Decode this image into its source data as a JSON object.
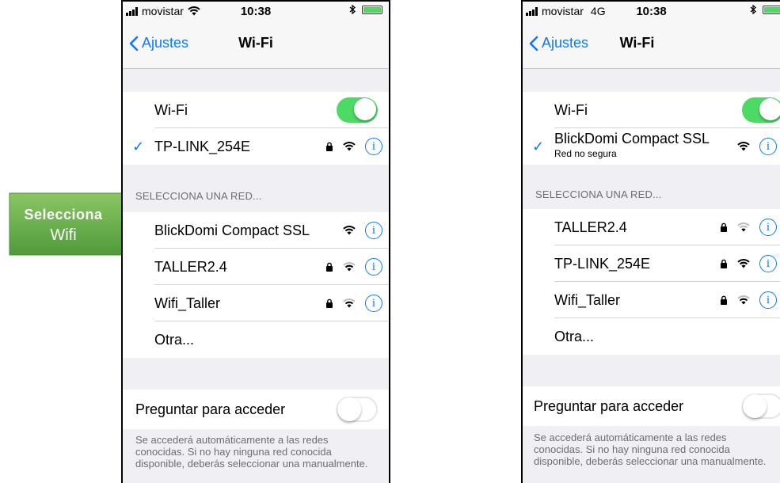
{
  "callout": {
    "line1": "Selecciona",
    "line2": "Wifi"
  },
  "left": {
    "status": {
      "carrier": "movistar",
      "time": "10:38"
    },
    "nav": {
      "back": "Ajustes",
      "title": "Wi-Fi"
    },
    "wifi_label": "Wi-Fi",
    "wifi_on": true,
    "connected": {
      "ssid": "TP-LINK_254E",
      "locked": true
    },
    "section_header": "SELECCIONA UNA RED...",
    "networks": [
      {
        "ssid": "BlickDomi Compact SSL",
        "locked": false
      },
      {
        "ssid": "TALLER2.4",
        "locked": true
      },
      {
        "ssid": "Wifi_Taller",
        "locked": true
      }
    ],
    "other": "Otra...",
    "ask_label": "Preguntar para acceder",
    "ask_on": false,
    "footnote": "Se accederá automáticamente a las redes conocidas. Si no hay ninguna red conocida disponible, deberás seleccionar una manualmente."
  },
  "right": {
    "status": {
      "carrier": "movistar",
      "network": "4G",
      "time": "10:38"
    },
    "nav": {
      "back": "Ajustes",
      "title": "Wi-Fi"
    },
    "wifi_label": "Wi-Fi",
    "wifi_on": true,
    "connected": {
      "ssid": "BlickDomi Compact SSL",
      "subtitle": "Red no segura",
      "locked": false
    },
    "section_header": "SELECCIONA UNA RED...",
    "networks": [
      {
        "ssid": "TALLER2.4",
        "locked": true
      },
      {
        "ssid": "TP-LINK_254E",
        "locked": true
      },
      {
        "ssid": "Wifi_Taller",
        "locked": true
      }
    ],
    "other": "Otra...",
    "ask_label": "Preguntar para acceder",
    "ask_on": false,
    "footnote": "Se accederá automáticamente a las redes conocidas. Si no hay ninguna red conocida disponible, deberás seleccionar una manualmente."
  },
  "colors": {
    "accent": "#0a7aff",
    "toggle_on": "#4cd964",
    "callout_green": "#6ab04c"
  },
  "icons": [
    "signal-icon",
    "wifi-icon",
    "bluetooth-icon",
    "battery-icon",
    "back-chevron-icon",
    "checkmark-icon",
    "lock-icon",
    "info-icon"
  ]
}
